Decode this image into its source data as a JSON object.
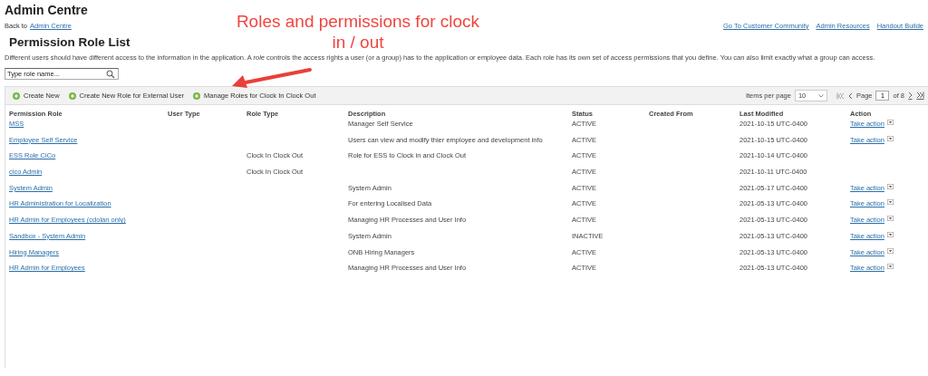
{
  "header": {
    "title": "Admin Centre",
    "back_text": "Back to",
    "back_link": "Admin Centre",
    "links": [
      "Go To Customer Community",
      "Admin Resources",
      "Handout Builde"
    ]
  },
  "page_title": "Permission Role List",
  "intro": "Different users should have different access to the information in the application. A *role* controls the access rights a user (or a group) has to the application or employee data. Each role has its own set of access permissions that you define. You can also limit exactly what a group can access.",
  "search": {
    "placeholder": "Type role name..."
  },
  "annotation": {
    "text": "Roles and permissions for clock in / out"
  },
  "toolbar": {
    "actions": [
      "Create New",
      "Create New Role for External User",
      "Manage Roles for Clock In Clock Out"
    ],
    "pager": {
      "items_label": "Items per page",
      "items_value": "10",
      "page_label": "Page",
      "page_value": "1",
      "of_label": "of 8"
    }
  },
  "table": {
    "columns": [
      "Permission Role",
      "User Type",
      "Role Type",
      "Description",
      "Status",
      "Created From",
      "Last Modified",
      "Action"
    ],
    "rows": [
      {
        "role": "MSS",
        "user_type": "",
        "role_type": "",
        "description": "Manager Self Service",
        "status": "ACTIVE",
        "last_modified": "2021-10-15 UTC-0400",
        "action": "Take action"
      },
      {
        "role": "Employee Self Service",
        "description": "Users can view and modify thier employee and development info",
        "status": "ACTIVE",
        "last_modified": "2021-10-15 UTC-0400",
        "action": "Take action"
      },
      {
        "role": "ESS Role CiCo",
        "role_type": "Clock In Clock Out",
        "description": "Role for ESS to Clock in and Clock Out",
        "status": "ACTIVE",
        "last_modified": "2021-10-14 UTC-0400"
      },
      {
        "role": "cico Admin",
        "role_type": "Clock In Clock Out",
        "status": "ACTIVE",
        "last_modified": "2021-10-11 UTC-0400"
      },
      {
        "role": "System Admin",
        "description": "System Admin",
        "status": "ACTIVE",
        "last_modified": "2021-05-17 UTC-0400",
        "action": "Take action"
      },
      {
        "role": "HR Administration for Localization",
        "description": "For entering Localised Data",
        "status": "ACTIVE",
        "last_modified": "2021-05-13 UTC-0400",
        "action": "Take action"
      },
      {
        "role": "HR Admin for Employees (cdolan only)",
        "description": "Managing HR Processes and User Info",
        "status": "ACTIVE",
        "last_modified": "2021-05-13 UTC-0400",
        "action": "Take action"
      },
      {
        "role": "Sandbox - System Admin",
        "description": "System Admin",
        "status": "INACTIVE",
        "last_modified": "2021-05-13 UTC-0400",
        "action": "Take action"
      },
      {
        "role": "Hiring Managers",
        "description": "ONB Hiring Managers",
        "status": "ACTIVE",
        "last_modified": "2021-05-13 UTC-0400",
        "action": "Take action"
      },
      {
        "role": "HR Admin for Employees",
        "description": "Managing HR Processes and User Info",
        "status": "ACTIVE",
        "last_modified": "2021-05-13 UTC-0400",
        "action": "Take action"
      }
    ]
  }
}
